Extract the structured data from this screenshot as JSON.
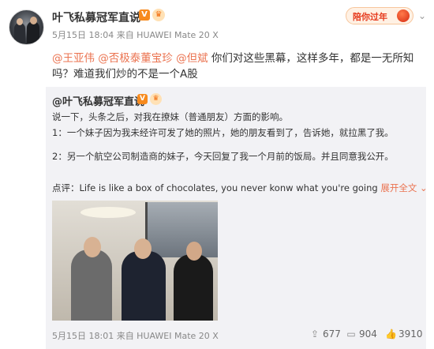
{
  "post": {
    "author": "叶飞私募冠军直说",
    "vip_mark": "V",
    "crown_mark": "♛",
    "meta": "5月15日 18:04 来自 HUAWEI Mate 20 X",
    "newyear_badge": "陪你过年",
    "mentions": [
      "@王亚伟",
      "@否极泰董宝珍",
      "@但斌"
    ],
    "text": " 你们对这些黑幕，这样多年，都是一无所知吗？难道我们炒的不是一个A股"
  },
  "repost": {
    "author": "@叶飞私募冠军直说",
    "lines": [
      "说一下，头条之后，对我在撩妹（普通朋友）方面的影响。",
      "1：一个妹子因为我未经许可发了她的照片，她的朋友看到了，告诉她，就拉黑了我。",
      "2：另一个航空公司制造商的妹子，今天回复了我一个月前的饭局。并且同意我公开。"
    ],
    "comment": "点评：Life is like a box of chocolates, you never konw what you're going",
    "expand_label": "展开全文",
    "expand_icon": "chevron-down",
    "footer_meta": "5月15日 18:01 来自 HUAWEI Mate 20 X",
    "repost_count": "677",
    "comment_count": "904",
    "like_count": "3910"
  }
}
